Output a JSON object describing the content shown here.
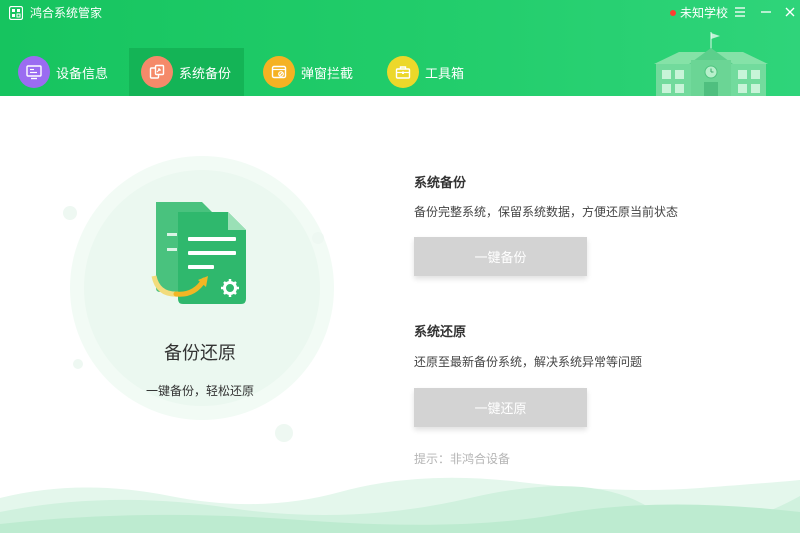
{
  "app": {
    "title": "鸿合系统管家",
    "school": "未知学校"
  },
  "tabs": [
    {
      "label": "设备信息",
      "icon": "monitor-icon",
      "color": "#9b6cf1",
      "active": false
    },
    {
      "label": "系统备份",
      "icon": "backup-icon",
      "color": "#f58a6a",
      "active": true
    },
    {
      "label": "弹窗拦截",
      "icon": "popup-block-icon",
      "color": "#f5b223",
      "active": false
    },
    {
      "label": "工具箱",
      "icon": "toolbox-icon",
      "color": "#ecd82a",
      "active": false
    }
  ],
  "feature": {
    "title": "备份还原",
    "subtitle": "一键备份，轻松还原"
  },
  "backup": {
    "title": "系统备份",
    "desc": "备份完整系统，保留系统数据，方便还原当前状态",
    "button": "一键备份"
  },
  "restore": {
    "title": "系统还原",
    "desc": "还原至最新备份系统，解决系统异常等问题",
    "button": "一键还原"
  },
  "hint": "提示：非鸿合设备",
  "colors": {
    "brand": "#1fc866",
    "tab_active": "#14b456",
    "button_disabled": "#d3d3d3",
    "hint_text": "#b5b5b5"
  }
}
